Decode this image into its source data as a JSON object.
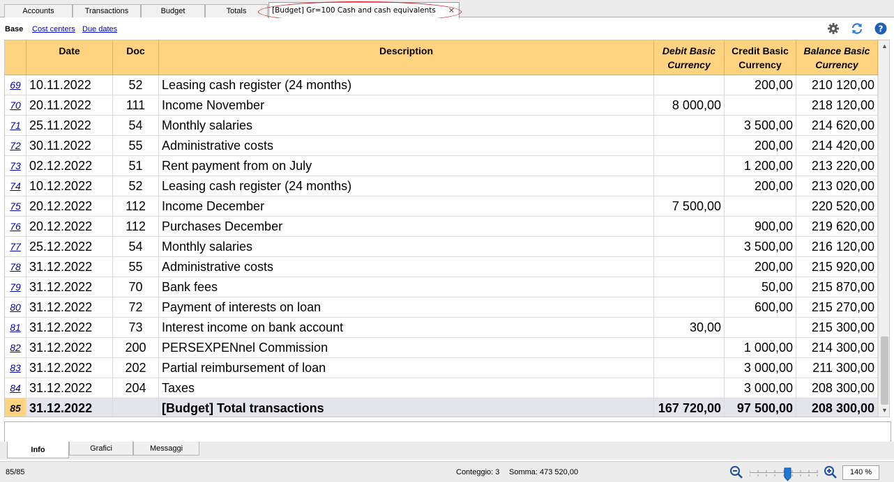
{
  "window": {
    "tabs": [
      {
        "label": "Accounts"
      },
      {
        "label": "Transactions"
      },
      {
        "label": "Budget"
      },
      {
        "label": "Totals"
      },
      {
        "label": "[Budget] Gr=100 Cash and cash equivalents"
      }
    ],
    "close_glyph": "×"
  },
  "subnav": {
    "base_label": "Base",
    "links": [
      {
        "label": "Cost centers"
      },
      {
        "label": "Due dates"
      }
    ]
  },
  "toolbar_icons": [
    "gear-icon",
    "refresh-icon",
    "help-icon"
  ],
  "table": {
    "headers": {
      "date": "Date",
      "doc": "Doc",
      "description": "Description",
      "debit_line1": "Debit Basic",
      "debit_line2": "Currency",
      "credit_line1": "Credit Basic",
      "credit_line2": "Currency",
      "balance_line1": "Balance Basic",
      "balance_line2": "Currency"
    },
    "rows": [
      {
        "n": "69",
        "date": "10.11.2022",
        "doc": "52",
        "desc": "Leasing cash register (24 months)",
        "debit": "",
        "credit": "200,00",
        "balance": "210 120,00"
      },
      {
        "n": "70",
        "date": "20.11.2022",
        "doc": "111",
        "desc": "Income November",
        "debit": "8 000,00",
        "credit": "",
        "balance": "218 120,00"
      },
      {
        "n": "71",
        "date": "25.11.2022",
        "doc": "54",
        "desc": "Monthly salaries",
        "debit": "",
        "credit": "3 500,00",
        "balance": "214 620,00"
      },
      {
        "n": "72",
        "date": "30.11.2022",
        "doc": "55",
        "desc": "Administrative costs",
        "debit": "",
        "credit": "200,00",
        "balance": "214 420,00"
      },
      {
        "n": "73",
        "date": "02.12.2022",
        "doc": "51",
        "desc": "Rent payment from on July",
        "debit": "",
        "credit": "1 200,00",
        "balance": "213 220,00"
      },
      {
        "n": "74",
        "date": "10.12.2022",
        "doc": "52",
        "desc": "Leasing cash register (24 months)",
        "debit": "",
        "credit": "200,00",
        "balance": "213 020,00"
      },
      {
        "n": "75",
        "date": "20.12.2022",
        "doc": "112",
        "desc": "Income December",
        "debit": "7 500,00",
        "credit": "",
        "balance": "220 520,00"
      },
      {
        "n": "76",
        "date": "20.12.2022",
        "doc": "112",
        "desc": "Purchases December",
        "debit": "",
        "credit": "900,00",
        "balance": "219 620,00"
      },
      {
        "n": "77",
        "date": "25.12.2022",
        "doc": "54",
        "desc": "Monthly salaries",
        "debit": "",
        "credit": "3 500,00",
        "balance": "216 120,00"
      },
      {
        "n": "78",
        "date": "31.12.2022",
        "doc": "55",
        "desc": "Administrative costs",
        "debit": "",
        "credit": "200,00",
        "balance": "215 920,00"
      },
      {
        "n": "79",
        "date": "31.12.2022",
        "doc": "70",
        "desc": "Bank fees",
        "debit": "",
        "credit": "50,00",
        "balance": "215 870,00"
      },
      {
        "n": "80",
        "date": "31.12.2022",
        "doc": "72",
        "desc": "Payment of interests on loan",
        "debit": "",
        "credit": "600,00",
        "balance": "215 270,00"
      },
      {
        "n": "81",
        "date": "31.12.2022",
        "doc": "73",
        "desc": "Interest income on bank account",
        "debit": "30,00",
        "credit": "",
        "balance": "215 300,00"
      },
      {
        "n": "82",
        "date": "31.12.2022",
        "doc": "200",
        "desc": "PERSEXPENnel Commission",
        "debit": "",
        "credit": "1 000,00",
        "balance": "214 300,00"
      },
      {
        "n": "83",
        "date": "31.12.2022",
        "doc": "202",
        "desc": "Partial reimbursement of loan",
        "debit": "",
        "credit": "3 000,00",
        "balance": "211 300,00"
      },
      {
        "n": "84",
        "date": "31.12.2022",
        "doc": "204",
        "desc": "Taxes",
        "debit": "",
        "credit": "3 000,00",
        "balance": "208 300,00"
      }
    ],
    "total": {
      "n": "85",
      "date": "31.12.2022",
      "doc": "",
      "desc": "[Budget] Total transactions",
      "debit": "167 720,00",
      "credit": "97 500,00",
      "balance": "208 300,00"
    }
  },
  "bottom_tabs": [
    {
      "label": "Info"
    },
    {
      "label": "Grafici"
    },
    {
      "label": "Messaggi"
    }
  ],
  "status": {
    "position": "85/85",
    "count": "Conteggio: 3",
    "sum": "Somma: 473 520,00",
    "zoom": "140 %"
  },
  "colors": {
    "header_bg": "#ffd481",
    "link": "#0000cc",
    "highlight_ellipse": "#d9202a"
  }
}
